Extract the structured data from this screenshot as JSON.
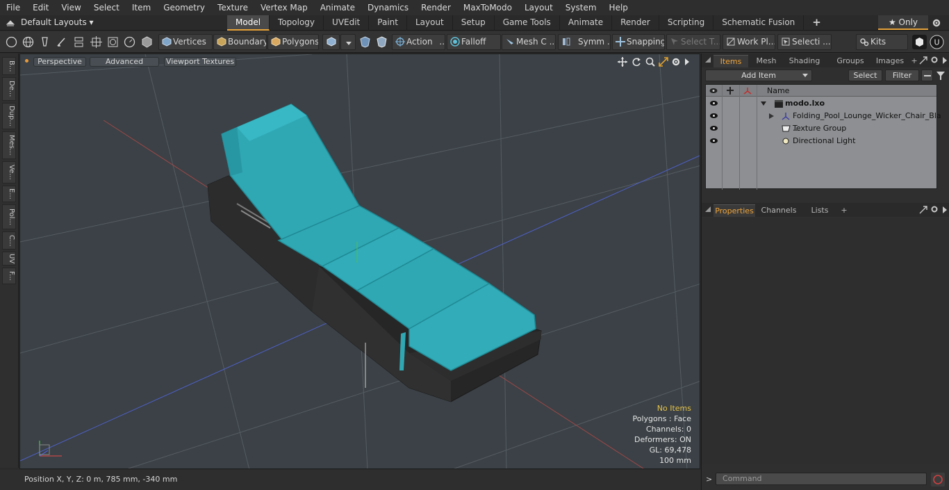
{
  "menubar": {
    "items": [
      "File",
      "Edit",
      "View",
      "Select",
      "Item",
      "Geometry",
      "Texture",
      "Vertex Map",
      "Animate",
      "Dynamics",
      "Render",
      "MaxToModo",
      "Layout",
      "System",
      "Help"
    ]
  },
  "layoutbar": {
    "layout_select": "Default Layouts ▾",
    "tabs": [
      "Model",
      "Topology",
      "UVEdit",
      "Paint",
      "Layout",
      "Setup",
      "Game Tools",
      "Animate",
      "Render",
      "Scripting",
      "Schematic Fusion"
    ],
    "active_tab": "Model",
    "add_tab": "+",
    "only_label": "★  Only"
  },
  "toolbar": {
    "vertices": "Vertices",
    "boundary": "Boundary",
    "polygons": "Polygons",
    "action": "Action",
    "action_more": "...",
    "falloff": "Falloff",
    "mesh": "Mesh C ...",
    "symm": "Symm ...",
    "snapping": "Snapping",
    "select_t": "Select T...",
    "work_pl": "Work Pl...",
    "selecti": "Selecti ...",
    "kits": "Kits"
  },
  "left_tabs": [
    "B...",
    "De...",
    "Dup...",
    "Mes...",
    "Ve...",
    "E...",
    "Pol...",
    "C...",
    "UV",
    "F..."
  ],
  "viewport": {
    "perspective": "Perspective",
    "advanced": "Advanced",
    "textures": "Viewport Textures",
    "info": {
      "no_items": "No Items",
      "polygons": "Polygons : Face",
      "channels": "Channels: 0",
      "deformers": "Deformers: ON",
      "gl": "GL: 69,478",
      "scale": "100 mm"
    }
  },
  "statusbar": {
    "position": "Position X, Y, Z:   0 m, 785 mm, -340 mm"
  },
  "rightpanel": {
    "top_tabs": [
      "Items",
      "Mesh ...",
      "Shading",
      "Groups",
      "Images"
    ],
    "active_top_tab": "Items",
    "add_item": "Add Item",
    "select": "Select",
    "filter": "Filter",
    "name_header": "Name",
    "items": [
      {
        "name": "modo.lxo"
      },
      {
        "name": "Folding_Pool_Lounge_Wicker_Chair_Bla ..."
      },
      {
        "name": "Texture Group"
      },
      {
        "name": "Directional Light"
      }
    ],
    "bottom_tabs": [
      "Properties",
      "Channels",
      "Lists"
    ],
    "active_bottom_tab": "Properties",
    "add_tab": "+",
    "command_placeholder": "Command",
    "command_prompt": ">"
  },
  "colors": {
    "accent": "#e8a33a",
    "cushion": "#2fa8b4",
    "frame": "#2a2a2a",
    "viewport_bg": "#3b4146"
  }
}
